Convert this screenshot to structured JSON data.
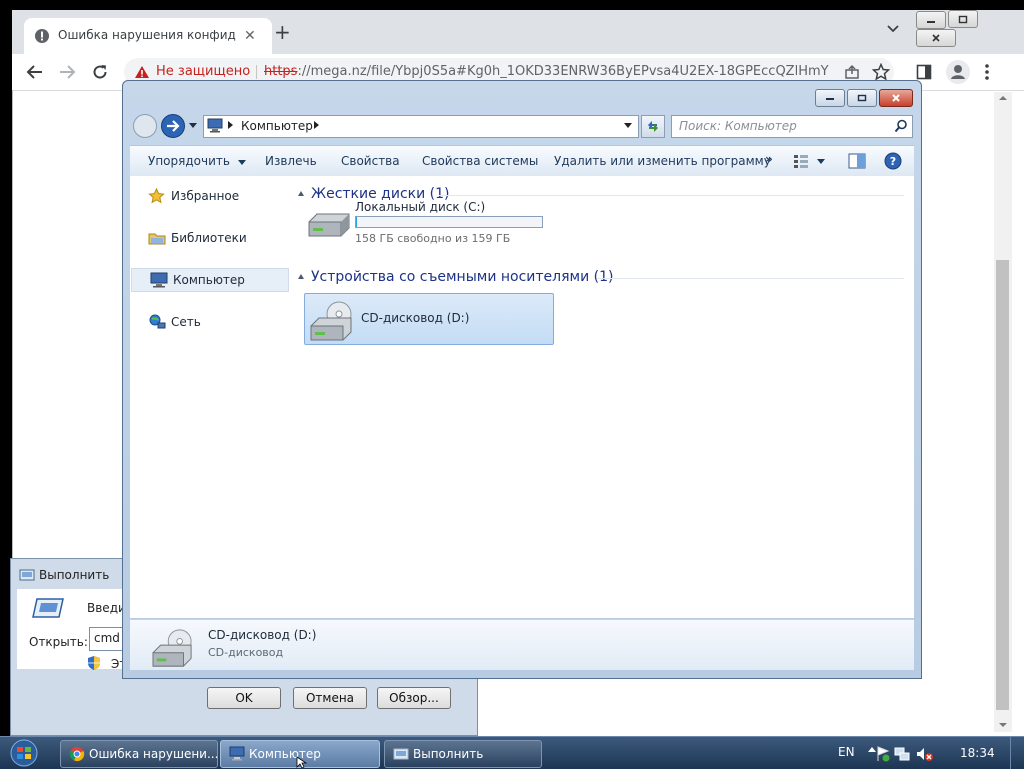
{
  "browser": {
    "tab_title": "Ошибка нарушения конфиденциальности",
    "new_tab_symbol": "+",
    "security_label": "Не защищено",
    "url_scheme": "https",
    "url_rest": "://mega.nz/file/Ybpj0S5a#Kg0h_1OKD33ENRW36ByEPvsa4U2EX-18GPEccQZlHmY"
  },
  "explorer": {
    "address": {
      "segment": "Компьютер"
    },
    "search_placeholder": "Поиск: Компьютер",
    "commands": {
      "organize": "Упорядочить",
      "eject": "Извлечь",
      "properties": "Свойства",
      "system_properties": "Свойства системы",
      "uninstall": "Удалить или изменить программу",
      "more": "»"
    },
    "nav": {
      "favorites": "Избранное",
      "libraries": "Библиотеки",
      "computer": "Компьютер",
      "network": "Сеть"
    },
    "groups": {
      "hard_drives": "Жесткие диски (1)",
      "removable": "Устройства со съемными носителями (1)"
    },
    "drive_c": {
      "name": "Локальный диск (C:)",
      "space": "158 ГБ свободно из 159 ГБ",
      "used_fraction": 0.006
    },
    "drive_d": {
      "name": "CD-дисковод (D:)"
    },
    "details": {
      "name": "CD-дисковод (D:)",
      "type": "CD-дисковод"
    }
  },
  "run_dialog": {
    "title": "Выполнить",
    "description": "Введите",
    "open_label": "Открыть:",
    "open_value": "cmd",
    "admin_note": "Эт",
    "ok": "OK",
    "cancel": "Отмена",
    "browse": "Обзор..."
  },
  "taskbar": {
    "items": [
      {
        "label": "Ошибка нарушени..."
      },
      {
        "label": "Компьютер"
      },
      {
        "label": "Выполнить"
      }
    ],
    "language": "EN",
    "clock": "18:34"
  }
}
